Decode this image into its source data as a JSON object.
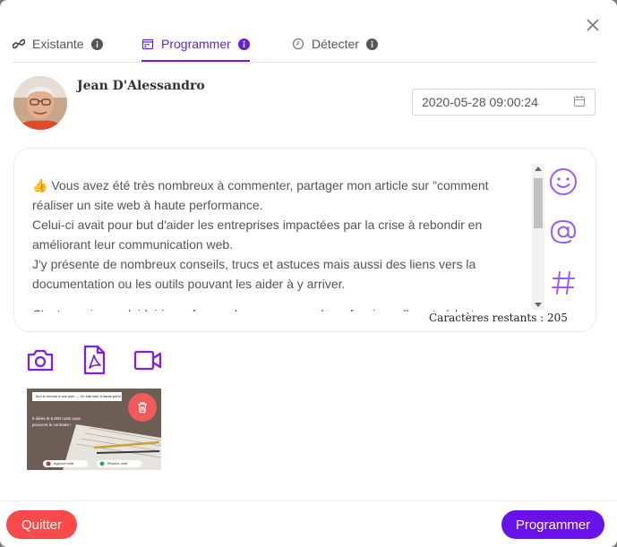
{
  "colors": {
    "accent": "#6a1fd0",
    "quit": "#f84a4a",
    "program": "#6a12ec",
    "trash": "#f25b5b"
  },
  "tabs": [
    {
      "label": "Existante",
      "icon": "link-icon",
      "active": false
    },
    {
      "label": "Programmer",
      "icon": "calendar-icon",
      "active": true
    },
    {
      "label": "Détecter",
      "icon": "clock-icon",
      "active": false
    }
  ],
  "author": {
    "name": "Jean D'Alessandro"
  },
  "schedule": {
    "datetime": "2020-05-28 09:00:24",
    "icon": "calendar-icon"
  },
  "post": {
    "lines": [
      "👍 Vous avez été très nombreux à commenter, partager mon article sur \"comment réaliser un site web à haute performance.",
      "Celui-ci avait pour but d'aider les entreprises impactées par la crise à rebondir en améliorant leur communication web.",
      "J'y présente de nombreux conseils, trucs et astuces mais aussi des liens vers la documentation ou les outils pouvant les aider à y arriver.",
      "C'est aussi une plaidoirie en faveur des agences web professionnelles et rédacteurs"
    ]
  },
  "editor_tools": [
    "smiley-icon",
    "at-icon",
    "hashtag-icon"
  ],
  "chars_remaining": "Caractères restants : 205",
  "media_buttons": [
    "camera-icon",
    "pdf-icon",
    "video-icon"
  ],
  "attachment": {
    "headline": "Tout le monde a son avis — Un site web à haute performance",
    "caption": "5 idées et 5.000 mots vous prouvent le contraire !",
    "chip_left": "Agence web",
    "chip_right": "Rédact. web"
  },
  "footer": {
    "quit_label": "Quitter",
    "program_label": "Programmer"
  }
}
